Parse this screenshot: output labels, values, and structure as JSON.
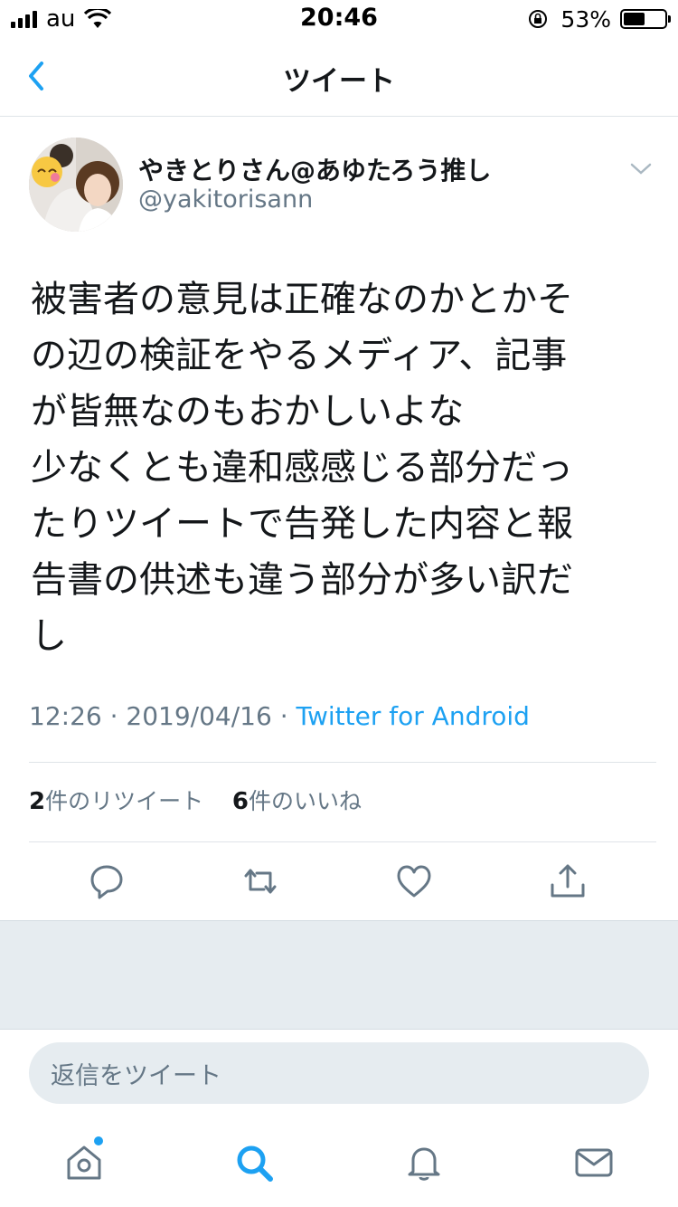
{
  "status_bar": {
    "carrier": "au",
    "time": "20:46",
    "battery_percent": "53%",
    "battery_level": 0.53
  },
  "nav": {
    "title": "ツイート",
    "back_icon": "chevron-left-icon"
  },
  "tweet": {
    "display_name": "やきとりさん@あゆたろう推し",
    "handle": "@yakitorisann",
    "lines": [
      "被害者の意見は正確なのかとかそ",
      "の辺の検証をやるメディア、記事",
      "が皆無なのもおかしいよな",
      "少なくとも違和感感じる部分だっ",
      "たりツイートで告発した内容と報",
      "告書の供述も違う部分が多い訳だ",
      "し"
    ],
    "time": "12:26",
    "date": "2019/04/16",
    "source": "Twitter for Android",
    "retweet_count": "2",
    "retweet_label": "件のリツイート",
    "like_count": "6",
    "like_label": "件のいいね"
  },
  "actions": [
    "reply-icon",
    "retweet-icon",
    "like-icon",
    "share-icon"
  ],
  "reply_box": {
    "placeholder": "返信をツイート"
  },
  "tabbar": {
    "items": [
      "home-icon",
      "search-icon",
      "notifications-icon",
      "messages-icon"
    ],
    "active": "search-icon"
  },
  "colors": {
    "accent": "#1da1f2",
    "secondary_text": "#657786",
    "divider": "#dfe4e8",
    "gray_background": "#e6ecf0"
  }
}
